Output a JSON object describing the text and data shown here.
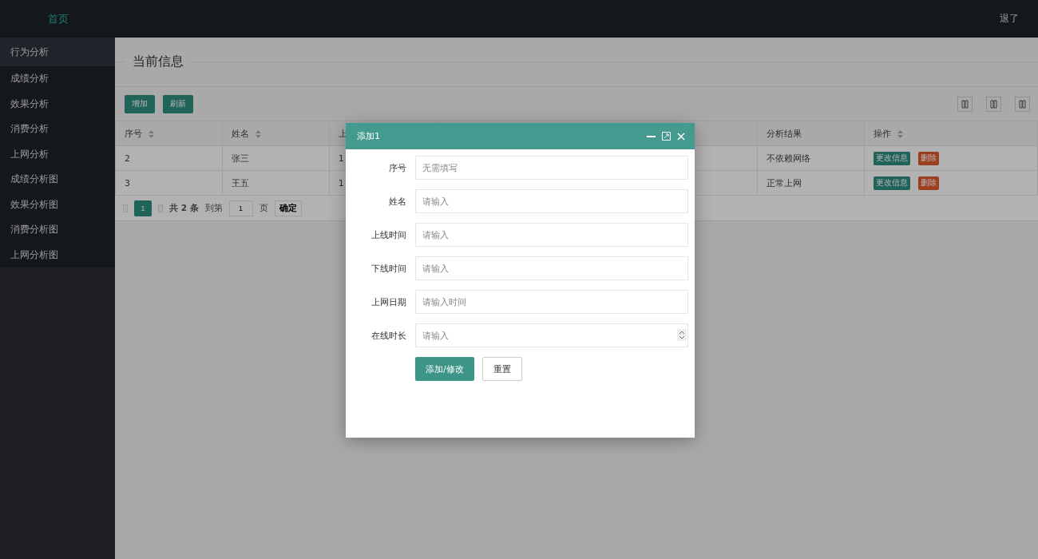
{
  "header": {
    "home": "首页",
    "logout": "退了"
  },
  "sidebar": {
    "items": [
      {
        "label": "行为分析",
        "selected": true
      },
      {
        "label": "成绩分析",
        "selected": false
      },
      {
        "label": "效果分析",
        "selected": false
      },
      {
        "label": "消费分析",
        "selected": false
      },
      {
        "label": "上网分析",
        "selected": false
      },
      {
        "label": "成绩分析图",
        "selected": false
      },
      {
        "label": "效果分析图",
        "selected": false
      },
      {
        "label": "消费分析图",
        "selected": false
      },
      {
        "label": "上网分析图",
        "selected": false
      }
    ]
  },
  "section_title": "当前信息",
  "toolbar": {
    "buttons": [
      "增加",
      "刷新"
    ]
  },
  "table": {
    "columns": [
      {
        "label": "序号",
        "sortable": true
      },
      {
        "label": "姓名",
        "sortable": true
      },
      {
        "label": "上",
        "sortable": false
      },
      {
        "label": "分析结果",
        "sortable": false
      },
      {
        "label": "操作",
        "sortable": true
      }
    ],
    "rows": [
      {
        "cells": [
          "2",
          "张三",
          "1",
          "不依赖网络"
        ],
        "edit": "更改信息",
        "delete": "删除"
      },
      {
        "cells": [
          "3",
          "王五",
          "1",
          "正常上网"
        ],
        "edit": "更改信息",
        "delete": "删除"
      }
    ]
  },
  "pagination": {
    "pages": [
      {
        "label": "1",
        "selected": true
      }
    ],
    "total": "共 2 条",
    "goto": "到第",
    "page_input": "1",
    "page_unit": "页",
    "confirm": "确定"
  },
  "dialog": {
    "title": "添加1",
    "fields": [
      {
        "label": "序号",
        "placeholder": "无需填写",
        "kind": "text"
      },
      {
        "label": "姓名",
        "placeholder": "请输入",
        "kind": "text"
      },
      {
        "label": "上线时间",
        "placeholder": "请输入",
        "kind": "text"
      },
      {
        "label": "下线时间",
        "placeholder": "请输入",
        "kind": "text"
      },
      {
        "label": "上网日期",
        "placeholder": "请输入时间",
        "kind": "text"
      },
      {
        "label": "在线时长",
        "placeholder": "请输入",
        "kind": "number"
      }
    ],
    "submit": "添加/修改",
    "reset": "重置"
  }
}
